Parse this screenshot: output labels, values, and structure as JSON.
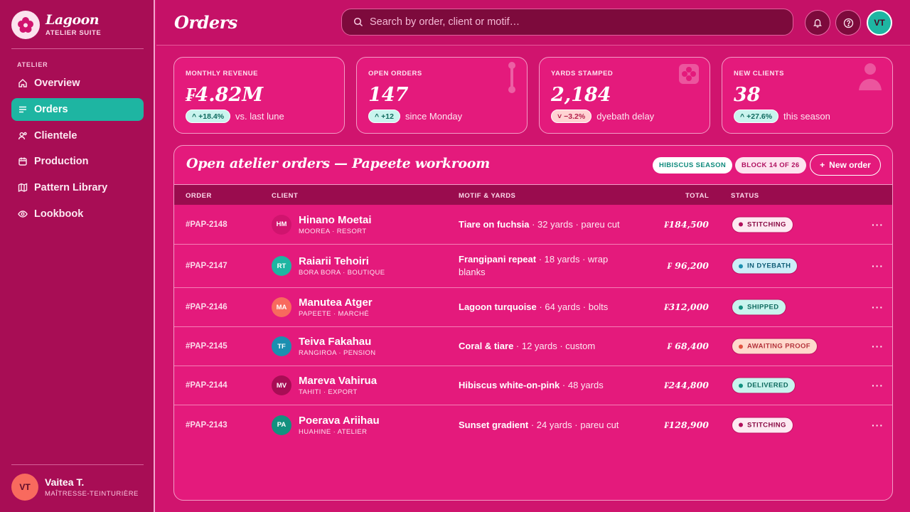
{
  "brand": {
    "name": "Lagoon",
    "subtitle": "ATELIER SUITE"
  },
  "sidebar": {
    "section": "ATELIER",
    "items": [
      {
        "label": "Overview",
        "icon": "home-icon",
        "active": false
      },
      {
        "label": "Orders",
        "icon": "list-icon",
        "active": true
      },
      {
        "label": "Clientele",
        "icon": "users-icon",
        "active": false
      },
      {
        "label": "Production",
        "icon": "calendar-icon",
        "active": false
      },
      {
        "label": "Pattern Library",
        "icon": "map-icon",
        "active": false
      },
      {
        "label": "Lookbook",
        "icon": "eye-icon",
        "active": false
      }
    ],
    "user": {
      "initials": "VT",
      "name": "Vaitea T.",
      "role": "MAÎTRESSE-TEINTURIÈRE"
    }
  },
  "header": {
    "title": "Orders",
    "search_placeholder": "Search by order, client or motif…",
    "avatar_initials": "VT"
  },
  "stats": [
    {
      "label": "MONTHLY REVENUE",
      "value": "₣4.82M",
      "delta": "+18.4%",
      "trend": "up",
      "note": "vs. last lune"
    },
    {
      "label": "OPEN ORDERS",
      "value": "147",
      "delta": "+12",
      "trend": "up",
      "note": "since Monday"
    },
    {
      "label": "YARDS STAMPED",
      "value": "2,184",
      "delta": "−3.2%",
      "trend": "down",
      "note": "dyebath delay"
    },
    {
      "label": "NEW CLIENTS",
      "value": "38",
      "delta": "+27.6%",
      "trend": "up",
      "note": "this season"
    }
  ],
  "orders_panel": {
    "title": "Open atelier orders — Papeete workroom",
    "season_pill": "HIBISCUS SEASON",
    "block_pill": "BLOCK 14 OF 26",
    "new_order_label": "New order",
    "columns": [
      "ORDER",
      "CLIENT",
      "MOTIF & YARDS",
      "TOTAL",
      "STATUS"
    ],
    "rows": [
      {
        "id": "#PAP-2148",
        "initials": "HM",
        "avatar_color": "#d0146e",
        "client": "Hinano Moetai",
        "location": "MOOREA · RESORT",
        "motif": "Tiare on fuchsia",
        "details": " · 32 yards · pareu cut",
        "total": "₣184,500",
        "status": "STITCHING",
        "status_kind": "stitch"
      },
      {
        "id": "#PAP-2147",
        "initials": "RT",
        "avatar_color": "#1eb5a2",
        "client": "Raiarii Tehoiri",
        "location": "BORA BORA · BOUTIQUE",
        "motif": "Frangipani repeat",
        "details": " · 18 yards · wrap blanks",
        "total": "₣ 96,200",
        "status": "IN DYEBATH",
        "status_kind": "dye"
      },
      {
        "id": "#PAP-2146",
        "initials": "MA",
        "avatar_color": "#f86a5e",
        "client": "Manutea Atger",
        "location": "PAPEETE · MARCHÉ",
        "motif": "Lagoon turquoise",
        "details": " · 64 yards · bolts",
        "total": "₣312,000",
        "status": "SHIPPED",
        "status_kind": "ship"
      },
      {
        "id": "#PAP-2145",
        "initials": "TF",
        "avatar_color": "#1b8fb0",
        "client": "Teiva Fakahau",
        "location": "RANGIROA · PENSION",
        "motif": "Coral & tiare",
        "details": " · 12 yards · custom",
        "total": "₣ 68,400",
        "status": "AWAITING PROOF",
        "status_kind": "await"
      },
      {
        "id": "#PAP-2144",
        "initials": "MV",
        "avatar_color": "#a80d55",
        "client": "Mareva Vahirua",
        "location": "TAHITI · EXPORT",
        "motif": "Hibiscus white-on-pink",
        "details": " · 48 yards",
        "total": "₣244,800",
        "status": "DELIVERED",
        "status_kind": "ship"
      },
      {
        "id": "#PAP-2143",
        "initials": "PA",
        "avatar_color": "#12917f",
        "client": "Poerava Ariihau",
        "location": "HUAHINE · ATELIER",
        "motif": "Sunset gradient",
        "details": " · 24 yards · pareu cut",
        "total": "₣128,900",
        "status": "STITCHING",
        "status_kind": "stitch"
      }
    ],
    "row_menu": "···"
  }
}
